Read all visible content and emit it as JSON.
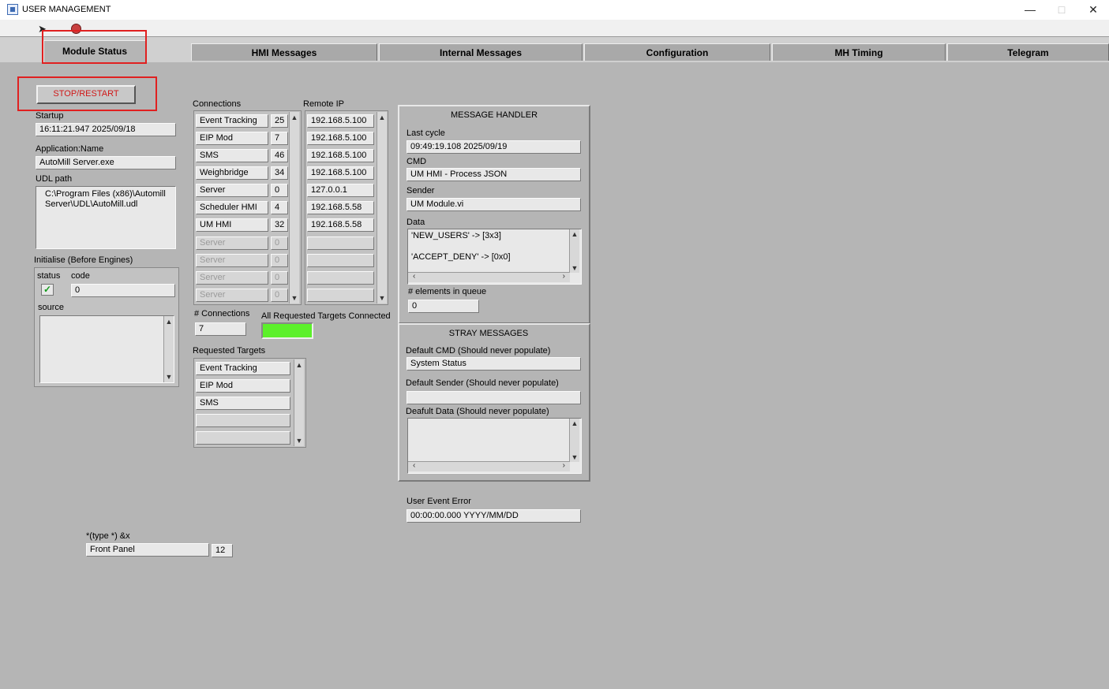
{
  "window": {
    "title": "USER MANAGEMENT"
  },
  "tabs": [
    {
      "label": "Module Status",
      "active": true
    },
    {
      "label": "HMI Messages",
      "active": false
    },
    {
      "label": "Internal Messages",
      "active": false
    },
    {
      "label": "Configuration",
      "active": false
    },
    {
      "label": "MH Timing",
      "active": false
    },
    {
      "label": "Telegram",
      "active": false
    }
  ],
  "left": {
    "stop_label": "STOP/RESTART",
    "startup_label": "Startup",
    "startup_value": "16:11:21.947 2025/09/18",
    "app_name_label": "Application:Name",
    "app_name_value": "AutoMill Server.exe",
    "udl_label": "UDL path",
    "udl_value": "C:\\Program Files (x86)\\Automill Server\\UDL\\AutoMill.udl",
    "init_label": "Initialise (Before Engines)",
    "status_label": "status",
    "code_label": "code",
    "code_value": "0",
    "source_label": "source"
  },
  "connections": {
    "label": "Connections",
    "remote_ip_label": "Remote IP",
    "rows": [
      {
        "name": "Event Tracking",
        "count": "25",
        "ip": "192.168.5.100"
      },
      {
        "name": "EIP Mod",
        "count": "7",
        "ip": "192.168.5.100"
      },
      {
        "name": "SMS",
        "count": "46",
        "ip": "192.168.5.100"
      },
      {
        "name": "Weighbridge",
        "count": "34",
        "ip": "192.168.5.100"
      },
      {
        "name": "Server",
        "count": "0",
        "ip": "127.0.0.1"
      },
      {
        "name": "Scheduler HMI",
        "count": "4",
        "ip": "192.168.5.58"
      },
      {
        "name": "UM HMI",
        "count": "32",
        "ip": "192.168.5.58"
      },
      {
        "name": "Server",
        "count": "0",
        "ip": ""
      },
      {
        "name": "Server",
        "count": "0",
        "ip": ""
      },
      {
        "name": "Server",
        "count": "0",
        "ip": ""
      },
      {
        "name": "Server",
        "count": "0",
        "ip": ""
      }
    ],
    "num_connections_label": "# Connections",
    "num_connections_value": "7",
    "all_connected_label": "All Requested Targets Connected",
    "requested_label": "Requested Targets",
    "requested": [
      "Event Tracking",
      "EIP Mod",
      "SMS",
      "",
      ""
    ]
  },
  "message_handler": {
    "title": "MESSAGE HANDLER",
    "last_cycle_label": "Last cycle",
    "last_cycle_value": "09:49:19.108 2025/09/19",
    "cmd_label": "CMD",
    "cmd_value": "UM HMI - Process JSON",
    "sender_label": "Sender",
    "sender_value": "UM Module.vi",
    "data_label": "Data",
    "data_line1": "'NEW_USERS' -> [3x3]",
    "data_line2": "'ACCEPT_DENY' -> [0x0]",
    "queue_label": "# elements in queue",
    "queue_value": "0"
  },
  "stray": {
    "title": "STRAY MESSAGES",
    "default_cmd_label": "Default CMD (Should never populate)",
    "default_cmd_value": "System Status",
    "default_sender_label": "Default Sender (Should never populate)",
    "default_sender_value": "",
    "default_data_label": "Deafult Data (Should never populate)"
  },
  "user_event": {
    "label": "User Event Error",
    "value": "00:00:00.000 YYYY/MM/DD"
  },
  "type_ctrl": {
    "label": "*(type *) &x",
    "value": "Front Panel",
    "num": "12"
  }
}
